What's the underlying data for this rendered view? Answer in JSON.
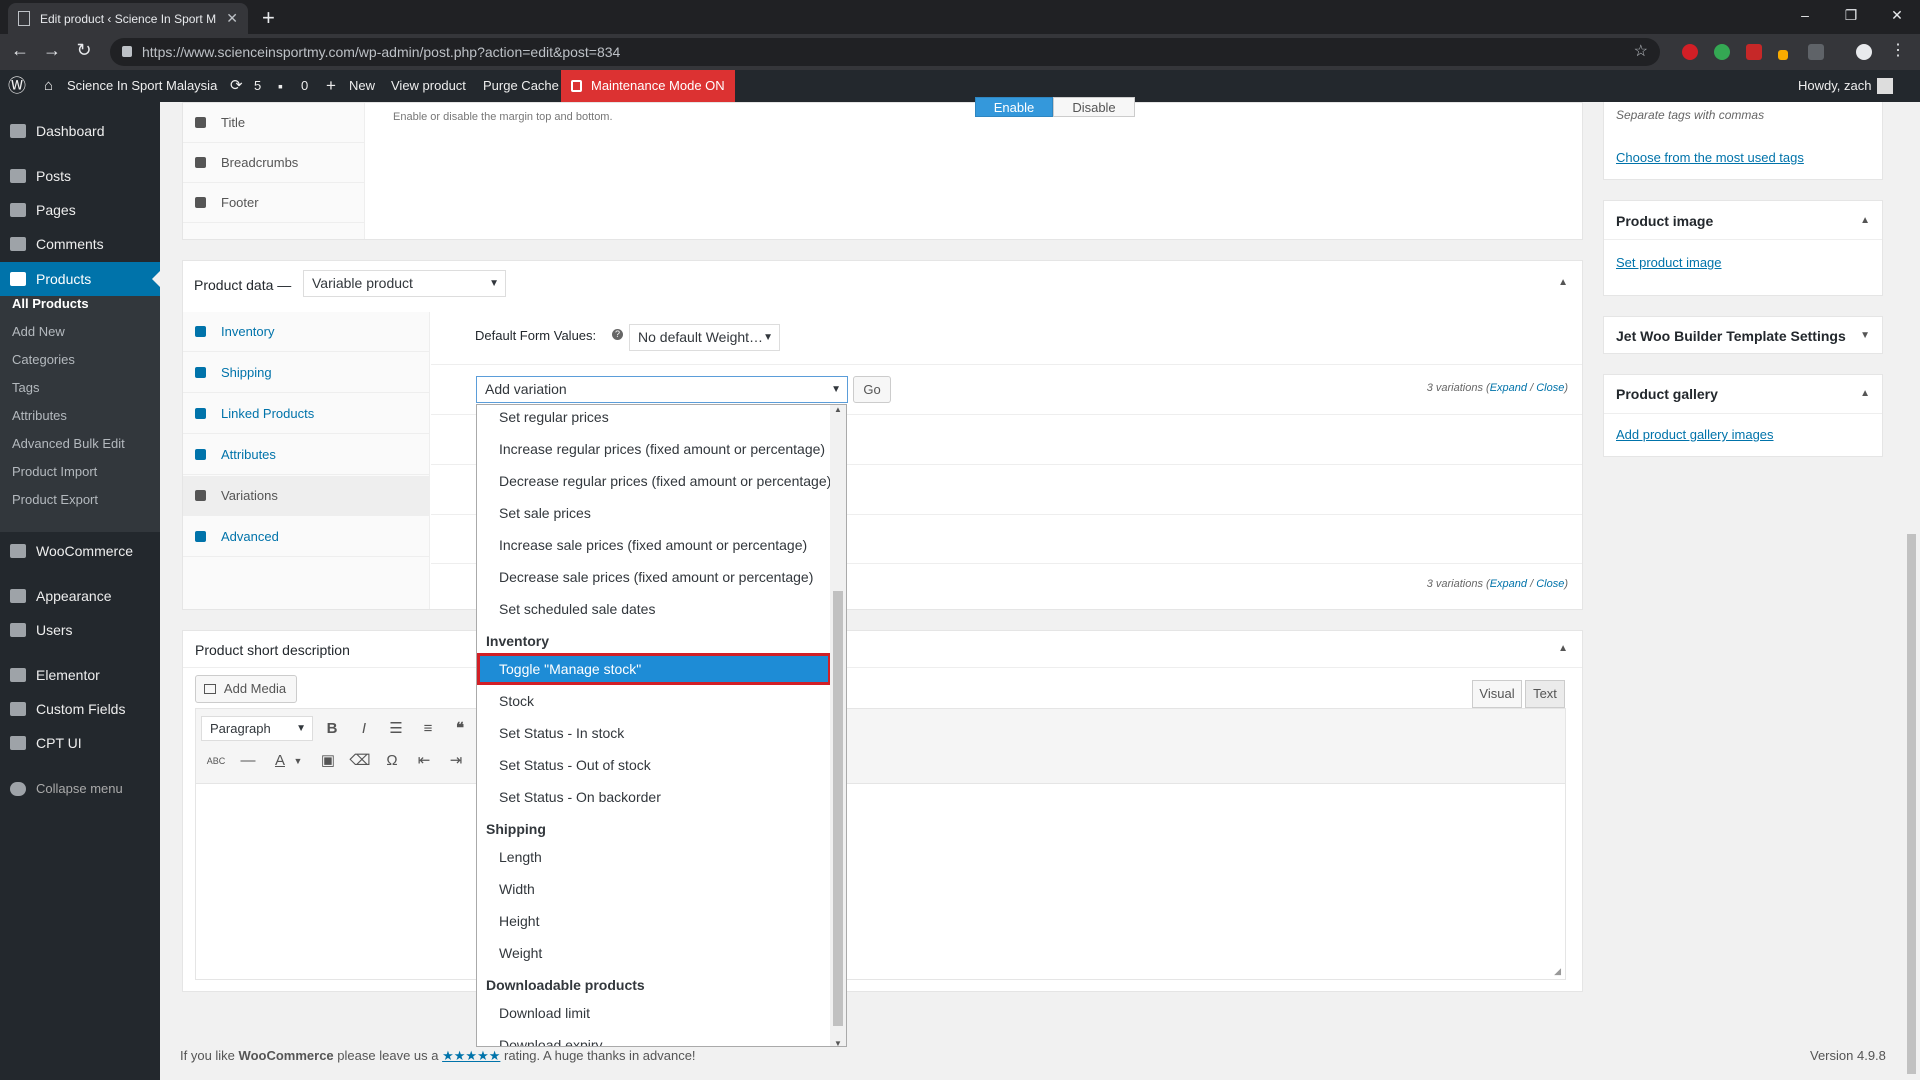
{
  "browser": {
    "tab_title": "Edit product ‹ Science In Sport M",
    "url": "https://www.scienceinsportmy.com/wp-admin/post.php?action=edit&post=834"
  },
  "adminbar": {
    "site_name": "Science In Sport Malaysia",
    "updates_count": "5",
    "comments_count": "0",
    "new_label": "New",
    "view_product": "View product",
    "purge_cache": "Purge Cache",
    "maintenance": "Maintenance Mode ON",
    "howdy": "Howdy, zach"
  },
  "sidebar": {
    "items": [
      "Dashboard",
      "Posts",
      "Pages",
      "Comments",
      "Products",
      "WooCommerce",
      "Appearance",
      "Users",
      "Elementor",
      "Custom Fields",
      "CPT UI",
      "Collapse menu"
    ],
    "submenu": [
      "All Products",
      "Add New",
      "Categories",
      "Tags",
      "Attributes",
      "Advanced Bulk Edit",
      "Product Import",
      "Product Export"
    ]
  },
  "layout_box": {
    "enable": "Enable",
    "disable": "Disable",
    "margin_hint": "Enable or disable the margin top and bottom.",
    "tabs": [
      "Title",
      "Breadcrumbs",
      "Footer"
    ]
  },
  "product_data": {
    "label": "Product data —",
    "type": "Variable product",
    "tabs": [
      "Inventory",
      "Shipping",
      "Linked Products",
      "Attributes",
      "Variations",
      "Advanced"
    ],
    "default_form_values": "Default Form Values:",
    "default_weight": "No default Weight…",
    "add_variation": "Add variation",
    "go": "Go",
    "variations_count": "3 variations",
    "expand": "Expand",
    "close": "Close"
  },
  "dropdown": {
    "options": [
      {
        "label": "Set regular prices",
        "kind": "opt"
      },
      {
        "label": "Increase regular prices (fixed amount or percentage)",
        "kind": "opt"
      },
      {
        "label": "Decrease regular prices (fixed amount or percentage)",
        "kind": "opt"
      },
      {
        "label": "Set sale prices",
        "kind": "opt"
      },
      {
        "label": "Increase sale prices (fixed amount or percentage)",
        "kind": "opt"
      },
      {
        "label": "Decrease sale prices (fixed amount or percentage)",
        "kind": "opt"
      },
      {
        "label": "Set scheduled sale dates",
        "kind": "opt"
      },
      {
        "label": "Inventory",
        "kind": "group"
      },
      {
        "label": "Toggle \"Manage stock\"",
        "kind": "opt",
        "selected": true
      },
      {
        "label": "Stock",
        "kind": "opt"
      },
      {
        "label": "Set Status - In stock",
        "kind": "opt"
      },
      {
        "label": "Set Status - Out of stock",
        "kind": "opt"
      },
      {
        "label": "Set Status - On backorder",
        "kind": "opt"
      },
      {
        "label": "Shipping",
        "kind": "group"
      },
      {
        "label": "Length",
        "kind": "opt"
      },
      {
        "label": "Width",
        "kind": "opt"
      },
      {
        "label": "Height",
        "kind": "opt"
      },
      {
        "label": "Weight",
        "kind": "opt"
      },
      {
        "label": "Downloadable products",
        "kind": "group"
      },
      {
        "label": "Download limit",
        "kind": "opt"
      },
      {
        "label": "Download expiry",
        "kind": "opt"
      }
    ]
  },
  "short_description": {
    "title": "Product short description",
    "add_media": "Add Media",
    "visual": "Visual",
    "text": "Text",
    "format": "Paragraph"
  },
  "right_sidebar": {
    "tags_hint": "Separate tags with commas",
    "tags_link": "Choose from the most used tags",
    "product_image": "Product image",
    "set_product_image": "Set product image",
    "jet_woo": "Jet Woo Builder Template Settings",
    "product_gallery": "Product gallery",
    "add_gallery": "Add product gallery images"
  },
  "footer": {
    "text_pre": "If you like",
    "brand": "WooCommerce",
    "text_mid": "please leave us a",
    "stars": "★★★★★",
    "text_post": "rating. A huge thanks in advance!",
    "version": "Version 4.9.8"
  }
}
